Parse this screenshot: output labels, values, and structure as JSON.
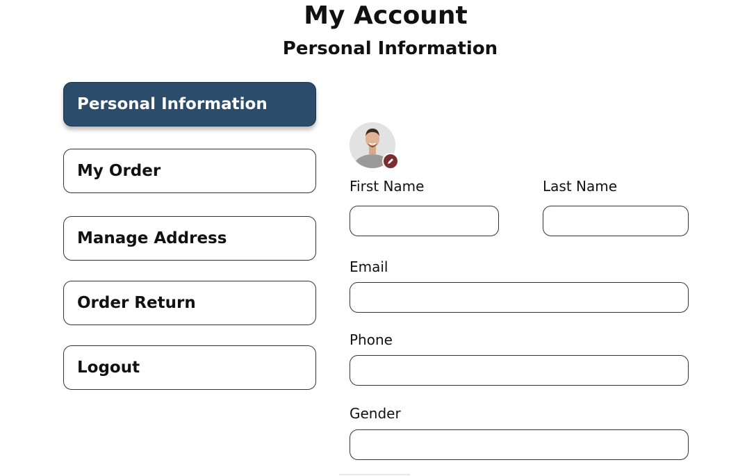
{
  "header": {
    "title": "My Account",
    "subtitle": "Personal Information"
  },
  "sidebar": {
    "items": [
      {
        "label": "Personal Information",
        "active": true
      },
      {
        "label": "My Order",
        "active": false
      },
      {
        "label": "Manage Address",
        "active": false
      },
      {
        "label": "Order Return",
        "active": false
      },
      {
        "label": "Logout",
        "active": false
      }
    ]
  },
  "profile": {
    "avatar_icon": "user-photo",
    "edit_icon": "pencil-icon",
    "edit_color": "#7a2e2e"
  },
  "form": {
    "first_name": {
      "label": "First Name",
      "value": ""
    },
    "last_name": {
      "label": "Last Name",
      "value": ""
    },
    "email": {
      "label": "Email",
      "value": ""
    },
    "phone": {
      "label": "Phone",
      "value": ""
    },
    "gender": {
      "label": "Gender",
      "value": ""
    }
  },
  "colors": {
    "active_nav": "#2b4c6a",
    "border": "#333333"
  }
}
